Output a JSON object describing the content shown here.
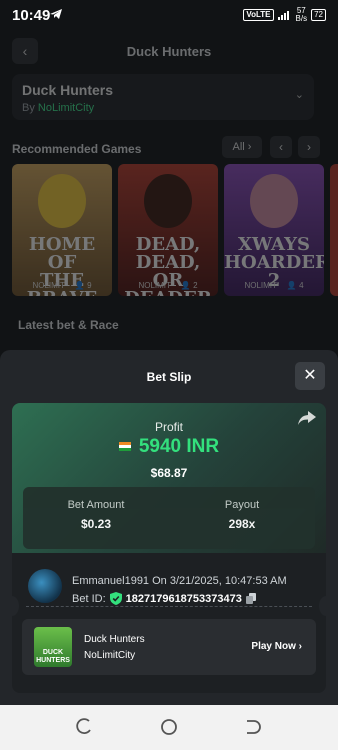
{
  "status_bar": {
    "time": "10:49",
    "volte": "VoLTE",
    "net_speed_top": "57",
    "net_speed_bottom": "B/s",
    "battery": "72"
  },
  "background_page": {
    "title": "Duck Hunters",
    "game_name": "Duck Hunters",
    "by_label": "By",
    "provider": "NoLimitCity",
    "recommended_label": "Recommended Games",
    "all_label": "All",
    "latest_label": "Latest bet & Race",
    "games": [
      {
        "title_line1": "HOME OF",
        "title_line2": "THE BRAVE",
        "brand": "NOLIMIT",
        "players": "9"
      },
      {
        "title_line1": "DEAD, DEAD,",
        "title_line2": "OR DEADER",
        "brand": "NOLIMIT",
        "players": "2"
      },
      {
        "title_line1": "XWAYS",
        "title_line2": "HOARDER 2",
        "brand": "NOLIMIT",
        "players": "4"
      }
    ]
  },
  "bet_slip": {
    "title": "Bet Slip",
    "profit_label": "Profit",
    "profit_value": "5940 INR",
    "profit_usd": "$68.87",
    "bet_amount_label": "Bet Amount",
    "bet_amount_value": "$0.23",
    "payout_label": "Payout",
    "payout_value": "298x",
    "user_line": "Emmanuel1991 On 3/21/2025, 10:47:53 AM",
    "bet_id_label": "Bet ID:",
    "bet_id_value": "1827179618753373473",
    "game": {
      "name": "Duck Hunters",
      "provider": "NoLimitCity",
      "thumb_text_1": "DUCK",
      "thumb_text_2": "HUNTERS",
      "play_label": "Play Now"
    }
  },
  "colors": {
    "accent_green": "#33e07d",
    "sheet_bg": "#23262a"
  }
}
